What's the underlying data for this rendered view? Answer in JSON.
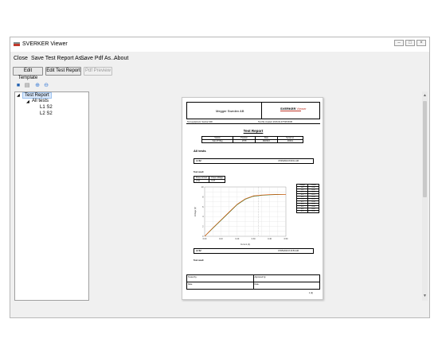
{
  "window": {
    "title": "SVERKER Viewer",
    "controls": [
      "minimize",
      "maximize",
      "close"
    ]
  },
  "menu": {
    "items": [
      "Close",
      "Save Test Report As...",
      "Save Pdf As...",
      "About"
    ]
  },
  "toolbar": {
    "edit_template": "Edit Template",
    "edit_test_report": "Edit Test Report",
    "pdf_preview": "Pdf Preview"
  },
  "icon_bar": [
    "save-icon",
    "print-icon",
    "zoom-in-icon",
    "zoom-out-icon"
  ],
  "tree": {
    "root": "Test Report",
    "group": "All tests",
    "children": [
      "L1 S2",
      "L2 S2"
    ]
  },
  "report": {
    "company": "Megger Sweden AB",
    "brand": "SVERKER",
    "brand_sub": "Viewer",
    "brand_color": "#c0392b",
    "meta_left": "Test equipment: Sverker 900",
    "meta_right": "Test file created: 2016-02-07T08:08:08",
    "title": "Test Report",
    "fields_header": [
      "Station",
      "Position",
      "Date",
      "Serial no."
    ],
    "fields_values": [
      "Sub ZT Bay",
      "1578",
      "08/2016",
      "00001"
    ],
    "all_tests": "All tests",
    "section1_label": "L1 S2",
    "section1_time": "07/05/2016 8:09:11 AM",
    "test_result": "Test result",
    "knee_headers": [
      "Knee current",
      "Knee voltage"
    ],
    "knee_values": [
      "2.64",
      "6.37"
    ],
    "section2_label": "L2 S2",
    "section2_time": "07/05/2016 8:13:54 AM",
    "test_result2": "Test result",
    "sig_tested_by": "Tested by:",
    "sig_approved_by": "Approved by:",
    "sig_date1": "Date:",
    "sig_date2": "Date:",
    "page_number": "1 (2)",
    "table_headers": [
      "Voltage",
      "Current"
    ]
  },
  "chart_data": {
    "type": "line",
    "title": "",
    "xlabel": "Current (A)",
    "ylabel": "Voltage (V)",
    "x": [
      0.0,
      0.05,
      0.1,
      0.15,
      0.2,
      0.25,
      0.3,
      0.35,
      0.4,
      0.45,
      0.5
    ],
    "series": [
      {
        "color": "#2e7d32",
        "values": [
          0.0,
          1.6,
          3.2,
          4.8,
          6.4,
          7.5,
          8.1,
          8.3,
          8.4,
          8.45,
          8.5
        ]
      },
      {
        "color": "#e65100",
        "values": [
          0.0,
          1.7,
          3.3,
          4.9,
          6.5,
          7.6,
          8.2,
          8.35,
          8.45,
          8.5,
          8.5
        ]
      }
    ],
    "xlim": [
      0,
      0.5
    ],
    "ylim": [
      0,
      10
    ],
    "grid": true,
    "knee_marker_x": 0.33
  }
}
